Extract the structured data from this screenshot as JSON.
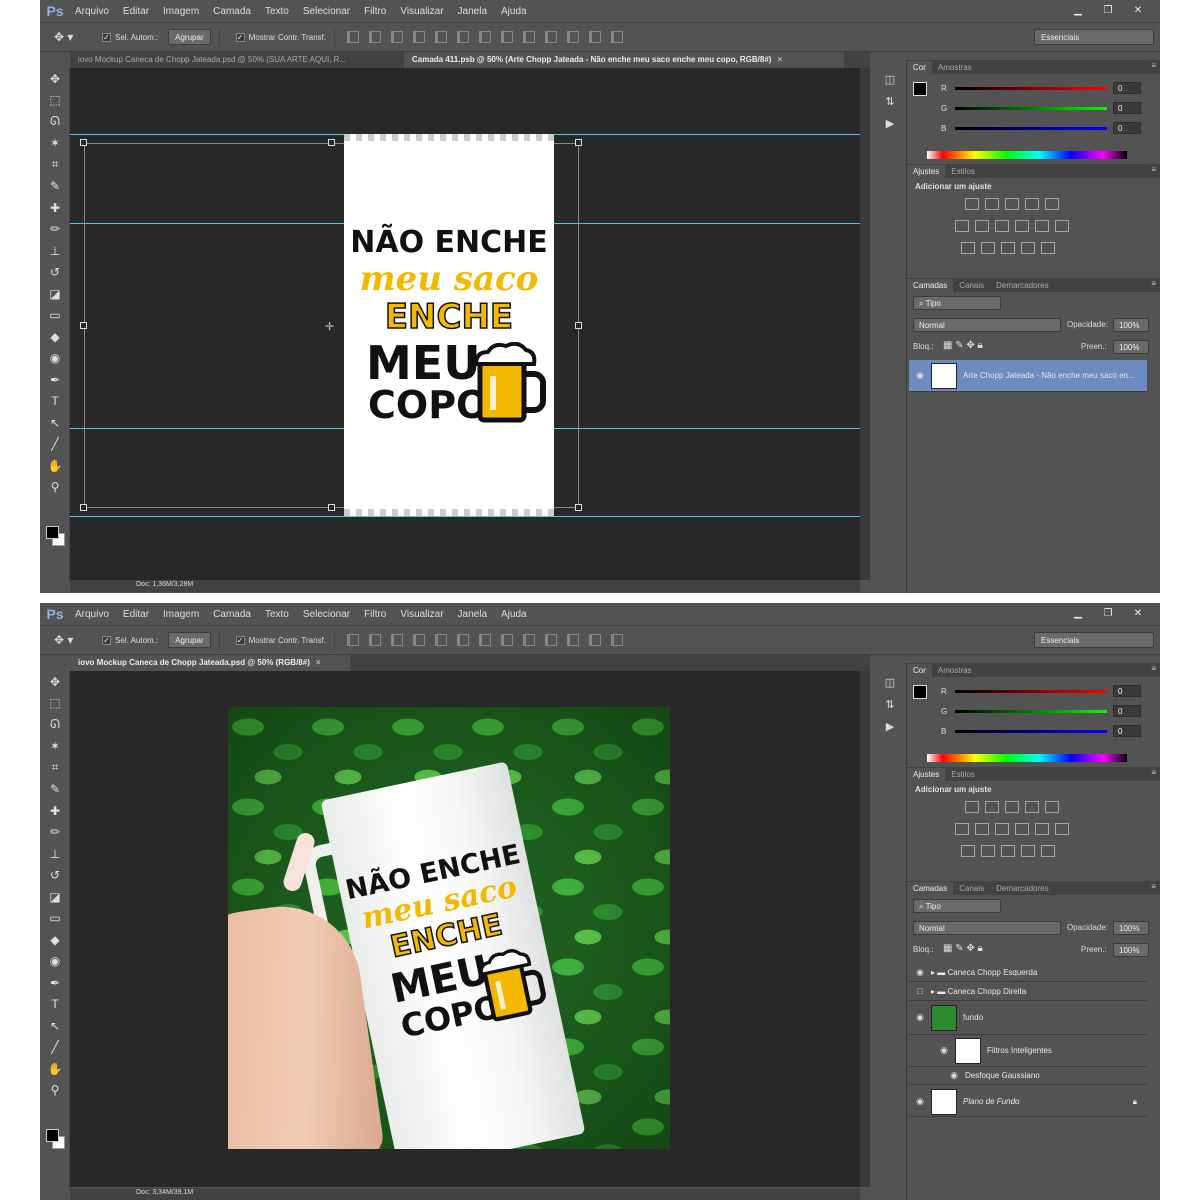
{
  "app_logo": "Ps",
  "menu": [
    "Arquivo",
    "Editar",
    "Imagem",
    "Camada",
    "Texto",
    "Selecionar",
    "Filtro",
    "Visualizar",
    "Janela",
    "Ajuda"
  ],
  "window_controls": {
    "minimize": "▁",
    "restore": "❐",
    "close": "✕"
  },
  "options": {
    "auto_select_label": "Sel. Autom.:",
    "group_value": "Agrupar",
    "show_transform_label": "Mostrar Contr. Transf.",
    "workspace": "Essenciais"
  },
  "tools": [
    "move-icon",
    "marquee-icon",
    "lasso-icon",
    "magic-wand-icon",
    "crop-icon",
    "eyedropper-icon",
    "healing-icon",
    "brush-icon",
    "stamp-icon",
    "history-brush-icon",
    "eraser-icon",
    "gradient-icon",
    "blur-icon",
    "dodge-icon",
    "pen-icon",
    "type-icon",
    "path-select-icon",
    "line-icon",
    "hand-icon",
    "zoom-icon"
  ],
  "tool_glyphs": [
    "✥",
    "⬚",
    "ᘏ",
    "✶",
    "⌗",
    "✎",
    "✚",
    "✏",
    "⊥",
    "↺",
    "◪",
    "▭",
    "◆",
    "◉",
    "✒",
    "T",
    "↖",
    "╱",
    "✋",
    "⚲"
  ],
  "color_panel": {
    "tabs": [
      "Cor",
      "Amostras"
    ],
    "r": "0",
    "g": "0",
    "b": "0",
    "labels": [
      "R",
      "G",
      "B"
    ]
  },
  "adjust_panel": {
    "tabs": [
      "Ajustes",
      "Estilos"
    ],
    "title": "Adicionar um ajuste"
  },
  "layers_panel_common": {
    "tabs": [
      "Camadas",
      "Canais",
      "Demarcadores"
    ],
    "filter": "Tipo",
    "opacity_label": "Opacidade:",
    "fill_label": "Preen.:",
    "lock_label": "Bloq.:",
    "opacity": "100%",
    "fill": "100%"
  },
  "screen1": {
    "tabs": [
      "iovo Mockup Caneca de Chopp Jateada.psd @ 50% (SUA ARTE AQUI, R...",
      "Camada 411.psb @ 50% (Arte Chopp Jateada - Não enche meu saco enche meu copo, RGB/8#)"
    ],
    "blend": "Normal",
    "layers": [
      {
        "name": "Arte Chopp Jateada - Não enche meu saco en..."
      }
    ],
    "status": "Doc: 1,36M/3,28M",
    "art": {
      "line1": "NÃO ENCHE",
      "line2": "meu saco",
      "line3": "ENCHE",
      "line4": "MEU",
      "line5": "COPO"
    }
  },
  "screen2": {
    "tabs": [
      "iovo Mockup Caneca de Chopp Jateada.psd @ 50% (RGB/8#)"
    ],
    "blend": "Normal",
    "layers": [
      {
        "name": "Caneca Chopp Esquerda"
      },
      {
        "name": "Caneca Chopp Direita"
      },
      {
        "name": "fundo"
      },
      {
        "name": "Filtros Inteligentes"
      },
      {
        "name": "Desfoque Gaussiano"
      },
      {
        "name": "Plano de Fundo"
      }
    ],
    "status": "Doc: 3,34M/39,1M",
    "art": {
      "line1": "NÃO ENCHE",
      "line2": "meu saco",
      "line3": "ENCHE",
      "line4": "MEU",
      "line5": "COPO"
    }
  }
}
